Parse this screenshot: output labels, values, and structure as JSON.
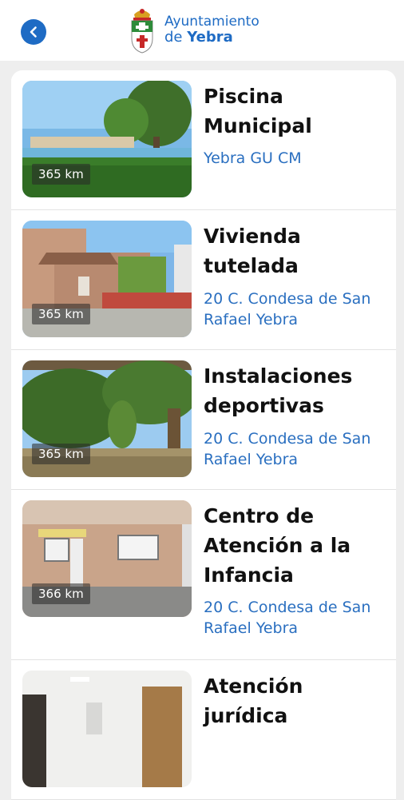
{
  "header": {
    "brand_line1": "Ayuntamiento",
    "brand_line2_prefix": "de ",
    "brand_line2_bold": "Yebra"
  },
  "colors": {
    "accent": "#1e6bc4",
    "link": "#2a6fc0"
  },
  "places": [
    {
      "title": "Piscina Municipal",
      "address": "Yebra GU CM",
      "distance": "365 km",
      "image": "pool-photo"
    },
    {
      "title": "Vivienda tutelada",
      "address": "20 C. Condesa de San Rafael Yebra",
      "distance": "365 km",
      "image": "house-photo"
    },
    {
      "title": "Instalaciones deportivas",
      "address": "20 C. Condesa de San Rafael Yebra",
      "distance": "365 km",
      "image": "tree-photo"
    },
    {
      "title": "Centro de Atención a la Infancia",
      "address": "20 C. Condesa de San Rafael Yebra",
      "distance": "366 km",
      "image": "building-photo"
    },
    {
      "title": "Atención jurídica",
      "address": "",
      "distance": "",
      "image": "office-photo"
    }
  ]
}
